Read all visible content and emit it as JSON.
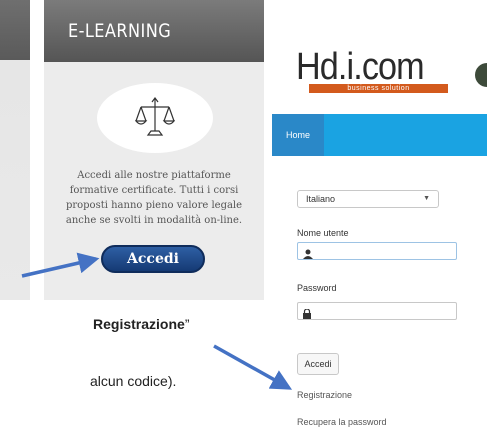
{
  "card": {
    "title": "E-LEARNING",
    "description": "Accedi alle nostre piattaforme formative certificate. Tutti i corsi proposti hanno pieno valore legale anche se svolti in modalità on-line.",
    "button_label": "Accedi",
    "icon": "scales-of-justice-icon"
  },
  "annotations": {
    "line1_bold": "Registrazione",
    "line1_quote": "”",
    "line2": "alcun codice)."
  },
  "login": {
    "logo_text": "Hd.i.com",
    "logo_tagline": "business solution",
    "nav_home": "Home",
    "language_value": "Italiano",
    "username_label": "Nome utente",
    "password_label": "Password",
    "submit_label": "Accedi",
    "register_link": "Registrazione",
    "recover_link": "Recupera la password",
    "user_icon": "user-icon",
    "lock_icon": "lock-icon"
  },
  "colors": {
    "nav_bar": "#1aa3e2",
    "nav_home": "#2a88c8",
    "card_button": "#1d4585",
    "arrow": "#4472c4",
    "logo_bar": "#d35a1d"
  }
}
